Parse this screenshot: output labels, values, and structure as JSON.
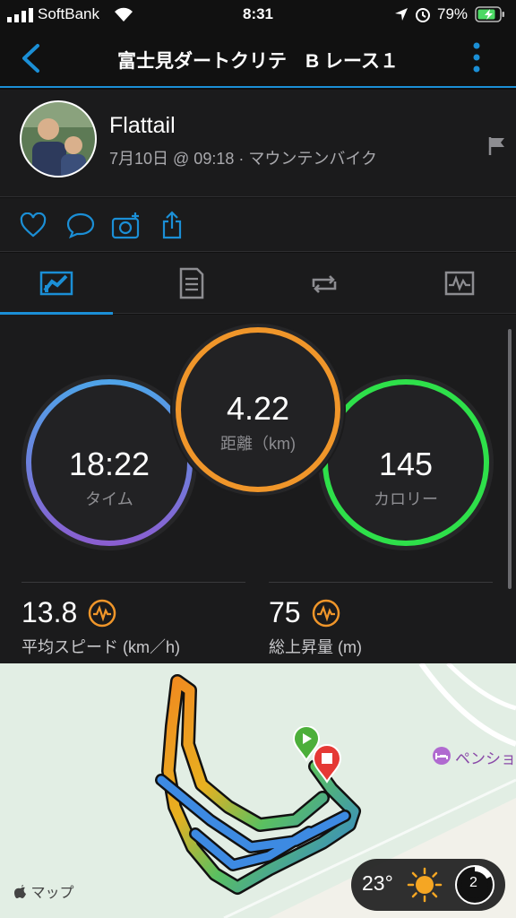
{
  "status_bar": {
    "carrier": "SoftBank",
    "time": "8:31",
    "battery": "79%"
  },
  "nav": {
    "title": "富士見ダートクリテ　B レース１"
  },
  "profile": {
    "name": "Flattail",
    "meta": "7月10日 @ 09:18 · マウンテンバイク"
  },
  "rings": {
    "time": {
      "value": "18:22",
      "caption": "タイム"
    },
    "distance": {
      "value": "4.22",
      "caption": "距離（km)"
    },
    "calories": {
      "value": "145",
      "caption": "カロリー"
    }
  },
  "metrics": {
    "speed": {
      "value": "13.8",
      "label": "平均スピード (km／h)"
    },
    "elevation": {
      "value": "75",
      "label": "総上昇量 (m)"
    }
  },
  "map": {
    "poi_label": "ペンショ",
    "logo": "マップ",
    "weather_temp": "23°",
    "wind_value": "2"
  },
  "colors": {
    "accent": "#1b8fd6",
    "ring_time": "#5a8fe0",
    "ring_distance": "#f0962a",
    "ring_calories": "#2ee04a"
  }
}
